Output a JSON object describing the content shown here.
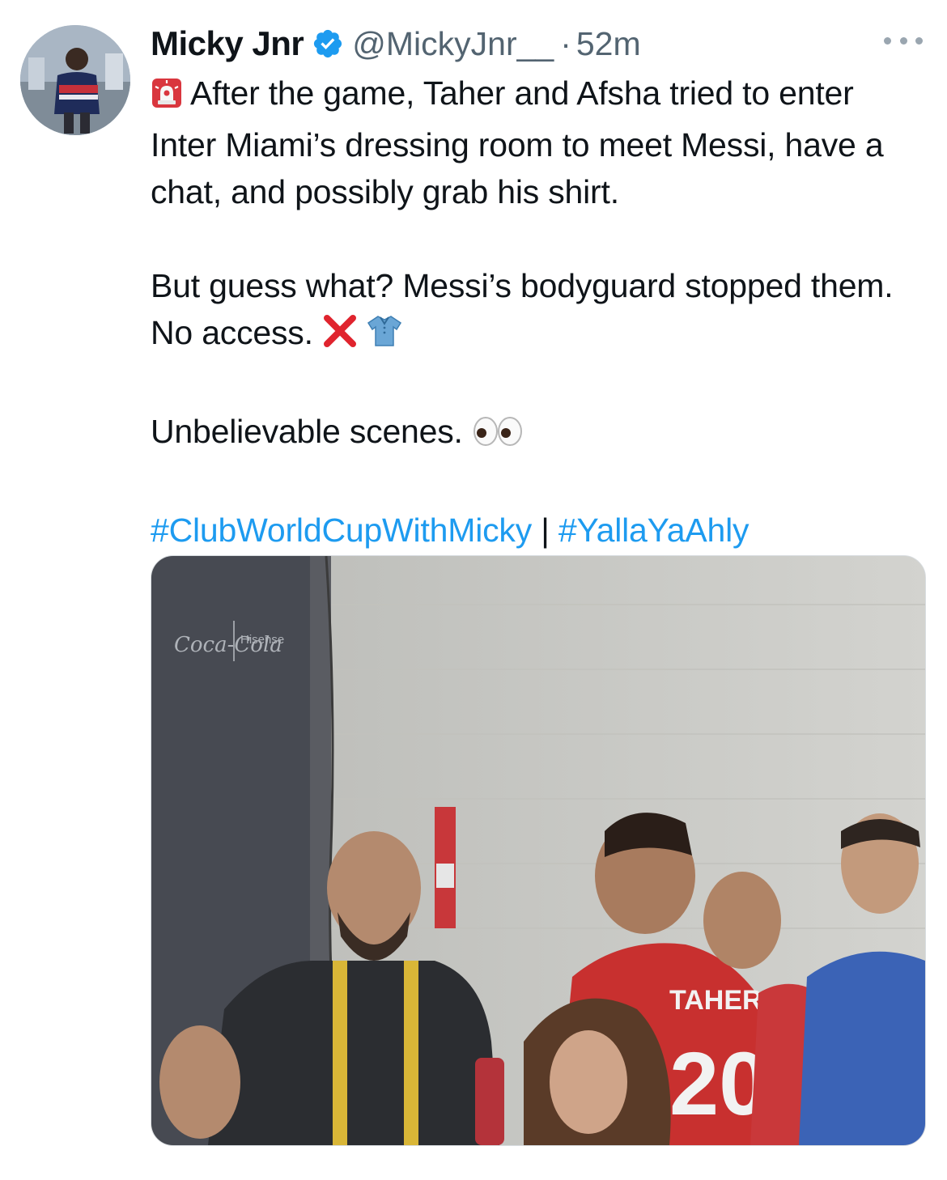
{
  "author": {
    "display_name": "Micky Jnr",
    "handle": "@MickyJnr__",
    "separator": "·",
    "timestamp": "52m",
    "verified_color": "#1d9bf0"
  },
  "tweet": {
    "line1": "After the game, Taher and Afsha tried to enter Inter Miami’s dressing room to meet Messi, have a chat, and possibly grab his shirt.",
    "line2": "But guess what? Messi’s bodyguard stopped them. No access.",
    "line3": "Unbelievable scenes.",
    "hashtag1": "#ClubWorldCupWithMicky",
    "pipe": "|",
    "hashtag2": "#YallaYaAhly",
    "emoji_siren": "siren-icon",
    "emoji_cross": "cross-mark-icon",
    "emoji_shirt": "shirt-icon",
    "emoji_eyes": "eyes-icon"
  },
  "media": {
    "sign_brand1": "Coca-Cola",
    "sign_brand2": "Hisense",
    "jersey_name": "TAHER",
    "jersey_number": "20"
  },
  "colors": {
    "link": "#1d9bf0",
    "secondary_text": "#536471"
  }
}
